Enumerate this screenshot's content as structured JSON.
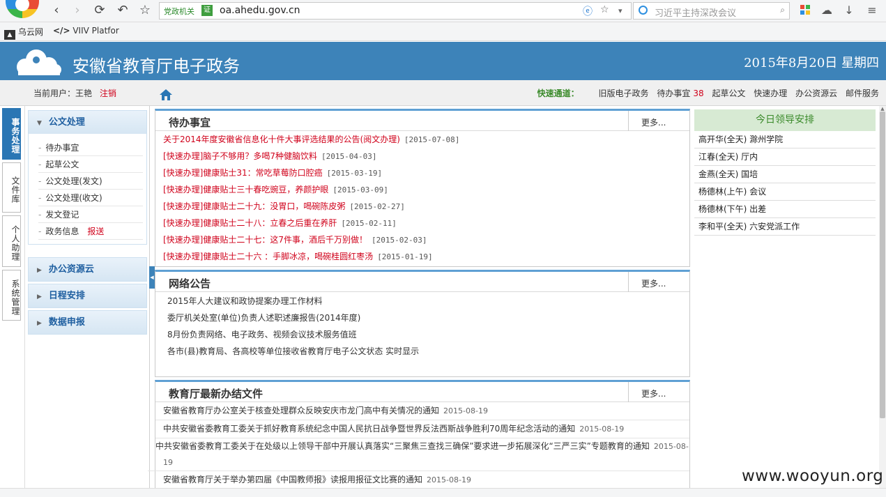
{
  "browser": {
    "nav_back": "‹",
    "nav_forward": "›",
    "reload": "⟳",
    "undo": "↶",
    "star": "☆",
    "gov_label": "党政机关",
    "gov_badge": "证",
    "url": "oa.ahedu.gov.cn",
    "search_placeholder": "习近平主持深改会议",
    "bookmarks": [
      "乌云网",
      "VIIV Platfor"
    ]
  },
  "header": {
    "title": "安徽省教育厅电子政务",
    "date": "2015年8月20日 星期四"
  },
  "status": {
    "current_user": "当前用户：王艳",
    "logout": "注销",
    "quick_label": "快速通道：",
    "links": [
      "旧版电子政务",
      "待办事宜",
      "起草公文",
      "快速办理",
      "办公资源云",
      "邮件服务"
    ],
    "pending_count": "38"
  },
  "vtabs": [
    "事务处理",
    "文件库",
    "个人助理",
    "系统管理"
  ],
  "sidebar": {
    "section_main": "公文处理",
    "items": [
      {
        "label": "待办事宜",
        "extra": ""
      },
      {
        "label": "起草公文",
        "extra": ""
      },
      {
        "label": "公文处理(发文)",
        "extra": ""
      },
      {
        "label": "公文处理(收文)",
        "extra": ""
      },
      {
        "label": "发文登记",
        "extra": ""
      },
      {
        "label": "政务信息",
        "extra": "报送"
      }
    ],
    "sections": [
      "办公资源云",
      "日程安排",
      "数据申报"
    ]
  },
  "pending": {
    "title": "待办事宜",
    "more": "更多...",
    "items": [
      {
        "text": "关于2014年度安徽省信息化十件大事评选结果的公告(阅文办理)",
        "date": "[2015-07-08]"
      },
      {
        "text": "[快速办理]脑子不够用？多喝7种健脑饮料",
        "date": "[2015-04-03]"
      },
      {
        "text": "[快速办理]健康贴士31：常吃草莓防口腔癌",
        "date": "[2015-03-19]"
      },
      {
        "text": "[快速办理]健康贴士三十春吃豌豆，养颜护眼",
        "date": "[2015-03-09]"
      },
      {
        "text": "[快速办理]健康贴士二十九：没胃口，喝碗陈皮粥",
        "date": "[2015-02-27]"
      },
      {
        "text": "[快速办理]健康贴士二十八：立春之后重在养肝",
        "date": "[2015-02-11]"
      },
      {
        "text": "[快速办理]健康贴士二十七：这7件事，酒后千万别做！",
        "date": "[2015-02-03]"
      },
      {
        "text": "[快速办理]健康贴士二十六 ：手脚冰凉，喝碗桂圆红枣汤",
        "date": "[2015-01-19]"
      }
    ]
  },
  "notices": {
    "title": "网络公告",
    "more": "更多...",
    "items": [
      "2015年人大建议和政协提案办理工作材料",
      "委厅机关处室(单位)负责人述职述廉报告(2014年度)",
      "8月份负责网络、电子政务、视频会议技术服务值班",
      "各市(县)教育局、各高校等单位接收省教育厅电子公文状态 实时显示"
    ]
  },
  "files": {
    "title": "教育厅最新办结文件",
    "more": "更多...",
    "items": [
      {
        "text": "安徽省教育厅办公室关于核查处理群众反映安庆市龙门高中有关情况的通知",
        "date": "2015-08-19"
      },
      {
        "text": "中共安徽省委教育工委关于抓好教育系统纪念中国人民抗日战争暨世界反法西斯战争胜利70周年纪念活动的通知",
        "date": "2015-08-19"
      },
      {
        "text": "中共安徽省委教育工委关于在处级以上领导干部中开展认真落实“三聚焦三查找三确保”要求进一步拓展深化“三严三实”专题教育的通知",
        "date": "2015-08-19"
      },
      {
        "text": "安徽省教育厅关于举办第四届《中国教师报》读报用报征文比赛的通知",
        "date": "2015-08-19"
      }
    ]
  },
  "leaders": {
    "title": "今日领导安排",
    "items": [
      "高开华(全天) 滁州学院",
      "江春(全天) 厅内",
      "金燕(全天) 国培",
      "杨德林(上午) 会议",
      "杨德林(下午) 出差",
      "李和平(全天) 六安党派工作"
    ]
  },
  "watermark": "www.wooyun.org",
  "colors": {
    "header_bg": "#3d83b9",
    "accent_red": "#d0021b",
    "accent_green": "#3a8a2a"
  }
}
